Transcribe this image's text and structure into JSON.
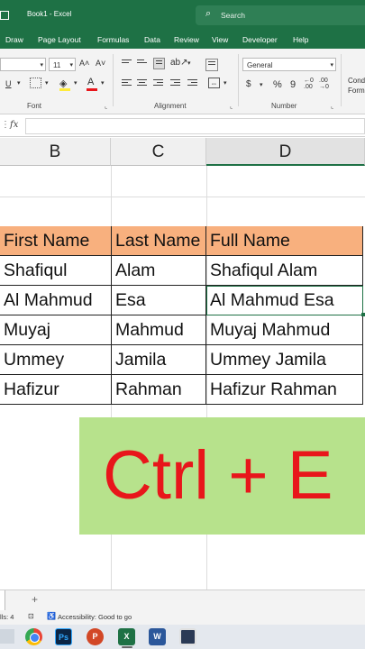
{
  "app": {
    "title": "Book1  -  Excel",
    "search_placeholder": "Search"
  },
  "menu": [
    "Draw",
    "Page Layout",
    "Formulas",
    "Data",
    "Review",
    "View",
    "Developer",
    "Help"
  ],
  "ribbon": {
    "font_size": "11",
    "grow_font": "A˄",
    "shrink_font": "A˅",
    "underline": "U",
    "font_color_letter": "A",
    "font_group": "Font",
    "alignment_group": "Alignment",
    "number_format": "General",
    "currency": "$",
    "percent": "%",
    "comma": "9",
    "number_group": "Number",
    "styles_partial": "Cond",
    "styles_partial2": "Form"
  },
  "formula_bar": {
    "fx": "fx",
    "value": ""
  },
  "columns": [
    "B",
    "C",
    "D"
  ],
  "table": {
    "headers": [
      "First Name",
      "Last Name",
      "Full Name"
    ],
    "rows": [
      [
        "Shafiqul",
        "Alam",
        "Shafiqul Alam"
      ],
      [
        "Al Mahmud",
        "Esa",
        "Al Mahmud Esa"
      ],
      [
        "Muyaj",
        "Mahmud",
        "Muyaj Mahmud"
      ],
      [
        "Ummey",
        "Jamila",
        "Ummey Jamila"
      ],
      [
        "Hafizur",
        "Rahman",
        "Hafizur Rahman"
      ]
    ]
  },
  "callout": {
    "text": "Ctrl + E"
  },
  "sheetbar": {
    "add": "+"
  },
  "status": {
    "cells": "lls: 4",
    "accessibility": "Accessibility: Good to go"
  },
  "colors": {
    "excel_green": "#1e7145",
    "header_fill": "#f8b07e",
    "callout_bg": "#b7e28c",
    "callout_text": "#e8161b"
  }
}
